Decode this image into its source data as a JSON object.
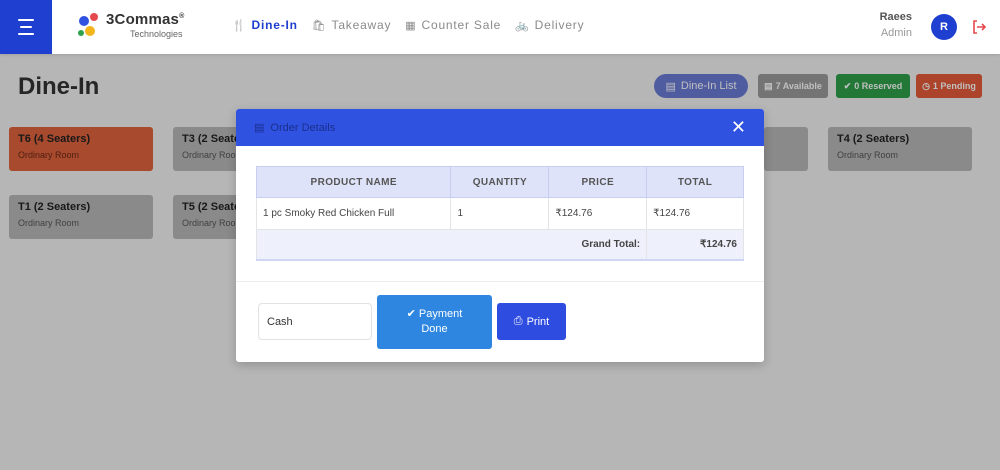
{
  "header": {
    "brand": {
      "name": "3Commas",
      "registered": "®",
      "sub": "Technologies"
    },
    "nav": [
      {
        "label": "Dine-In",
        "active": true,
        "icon": "utensils-icon"
      },
      {
        "label": "Takeaway",
        "active": false,
        "icon": "bag-icon"
      },
      {
        "label": "Counter Sale",
        "active": false,
        "icon": "register-icon"
      },
      {
        "label": "Delivery",
        "active": false,
        "icon": "bicycle-icon"
      }
    ],
    "user": {
      "name": "Raees",
      "role": "Admin",
      "initial": "R"
    }
  },
  "page": {
    "title": "Dine-In",
    "list_button": "Dine-In List",
    "badges": {
      "available": "7 Available",
      "reserved": "0 Reserved",
      "pending": "1 Pending"
    },
    "tables": [
      {
        "name": "T6 (4 Seaters)",
        "room": "Ordinary Room",
        "status": "pending"
      },
      {
        "name": "T3  (2 Seaters)",
        "room": "Ordinary Room",
        "status": "available"
      },
      {
        "name": "T4  (2 Seaters)",
        "room": "Ordinary Room",
        "status": "available"
      },
      {
        "name": "T1  (2 Seaters)",
        "room": "Ordinary Room",
        "status": "available"
      },
      {
        "name": "T5  (2 Seaters)",
        "room": "Ordinary Room",
        "status": "available"
      }
    ]
  },
  "modal": {
    "title": "Order Details",
    "columns": [
      "PRODUCT NAME",
      "QUANTITY",
      "PRICE",
      "TOTAL"
    ],
    "rows": [
      {
        "product": "1 pc Smoky Red Chicken Full",
        "quantity": "1",
        "price": "₹124.76",
        "total": "₹124.76"
      }
    ],
    "grand_total_label": "Grand Total:",
    "grand_total": "₹124.76",
    "payment_method": "Cash",
    "payment_button": {
      "line1": "Payment",
      "line2": "Done"
    },
    "print_button": "Print"
  },
  "colors": {
    "primary": "#1e3fcf",
    "modal_header": "#2f52e0",
    "pending": "#e45b3a",
    "reserved": "#2fa14a",
    "available": "#9b9b9b"
  }
}
